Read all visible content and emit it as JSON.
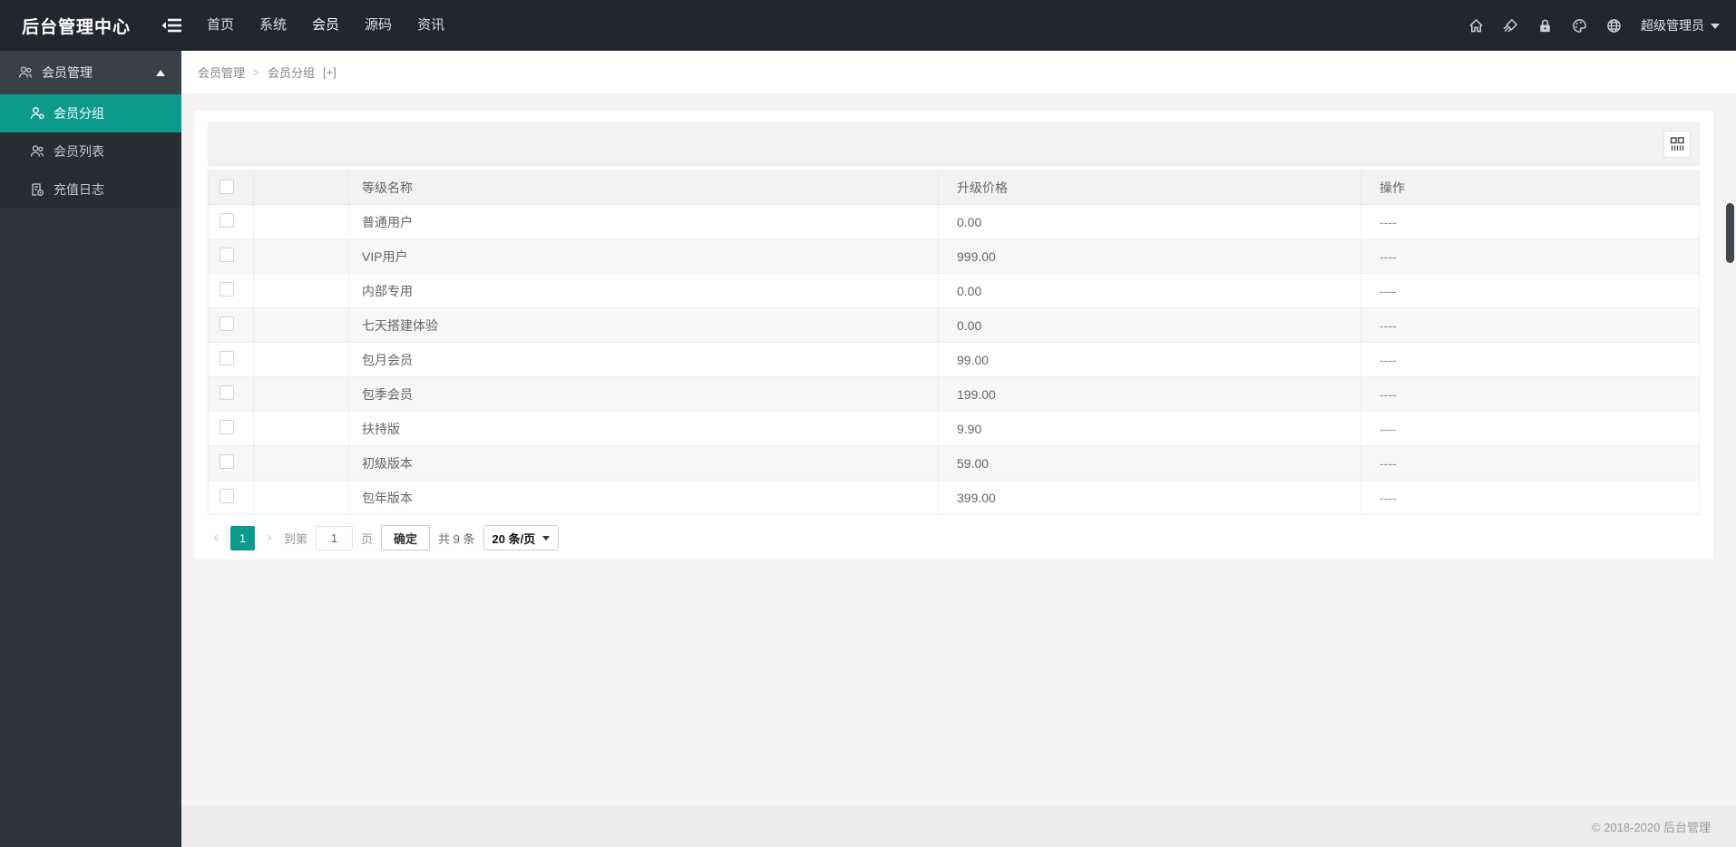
{
  "navbar": {
    "brand": "后台管理中心",
    "menus": [
      {
        "label": "首页"
      },
      {
        "label": "系统"
      },
      {
        "label": "会员"
      },
      {
        "label": "源码"
      },
      {
        "label": "资讯"
      }
    ],
    "active_menu": "会员",
    "user_label": "超级管理员"
  },
  "sidebar": {
    "group_label": "会员管理",
    "items": [
      {
        "label": "会员分组"
      },
      {
        "label": "会员列表"
      },
      {
        "label": "充值日志"
      }
    ],
    "active_item": "会员分组"
  },
  "breadcrumb": {
    "root": "会员管理",
    "separator": ">",
    "current": "会员分组",
    "suffix": "[+]"
  },
  "table": {
    "columns": {
      "name": "等级名称",
      "price": "升级价格",
      "op": "操作"
    },
    "rows": [
      {
        "name": "普通用户",
        "price": "0.00",
        "op": "----"
      },
      {
        "name": "VIP用户",
        "price": "999.00",
        "op": "----"
      },
      {
        "name": "内部专用",
        "price": "0.00",
        "op": "----"
      },
      {
        "name": "七天搭建体验",
        "price": "0.00",
        "op": "----"
      },
      {
        "name": "包月会员",
        "price": "99.00",
        "op": "----"
      },
      {
        "name": "包季会员",
        "price": "199.00",
        "op": "----"
      },
      {
        "name": "扶持版",
        "price": "9.90",
        "op": "----"
      },
      {
        "name": "初级版本",
        "price": "59.00",
        "op": "----"
      },
      {
        "name": "包年版本",
        "price": "399.00",
        "op": "----"
      }
    ]
  },
  "pagination": {
    "prev": "‹",
    "current_page": "1",
    "next": "›",
    "goto_label": "到第",
    "page_input_value": "1",
    "page_unit": "页",
    "confirm_label": "确定",
    "total_label": "共 9 条",
    "page_size_label": "20 条/页"
  },
  "footer": {
    "copyright": "© 2018-2020 后台管理"
  },
  "colors": {
    "accent": "#0c9a8a",
    "navbar_bg": "#23262e",
    "sidebar_bg": "#2f333b",
    "table_header_bg": "#f2f2f2",
    "stripe_row_bg": "#f7f7f7",
    "footer_bg": "#ececec"
  },
  "icons": {
    "toggle": "outdent-icon",
    "home": "home-icon",
    "clear_cache": "brush-icon",
    "lock": "lock-icon",
    "theme": "palette-icon",
    "language": "globe-icon",
    "user_caret": "caret-down-icon",
    "group_caret": "caret-up-icon",
    "column_toggle": "columns-icon"
  }
}
